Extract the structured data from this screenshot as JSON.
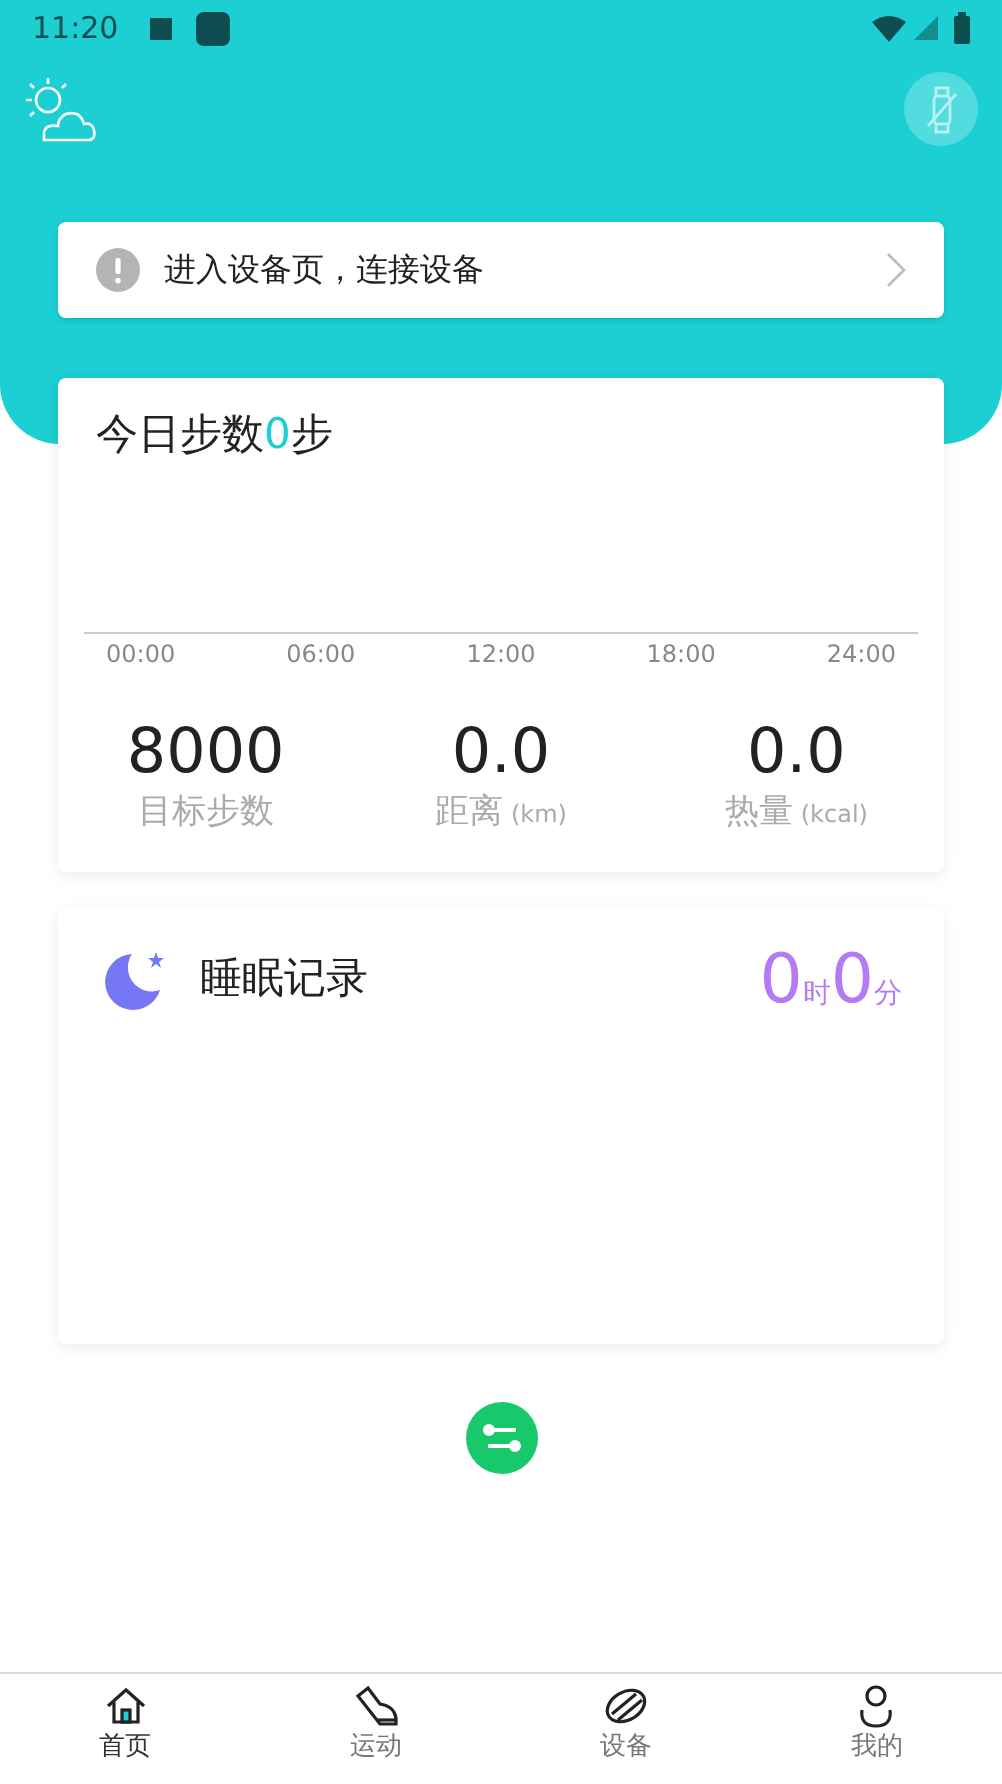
{
  "status_bar": {
    "time": "11:20"
  },
  "notice": {
    "text": "进入设备页，连接设备"
  },
  "steps": {
    "title_prefix": "今日步数",
    "count": "0",
    "title_suffix": "步",
    "axis_labels": [
      "00:00",
      "06:00",
      "12:00",
      "18:00",
      "24:00"
    ],
    "stats": [
      {
        "value": "8000",
        "label": "目标步数"
      },
      {
        "value": "0.0",
        "label": "距离",
        "unit": "(km)"
      },
      {
        "value": "0.0",
        "label": "热量",
        "unit": "(kcal)"
      }
    ]
  },
  "sleep": {
    "title": "睡眠记录",
    "hours": "0",
    "hours_unit": "时",
    "minutes": "0",
    "minutes_unit": "分"
  },
  "nav": [
    {
      "label": "首页",
      "kind": "home",
      "selected": true
    },
    {
      "label": "运动",
      "kind": "shoe",
      "selected": false
    },
    {
      "label": "设备",
      "kind": "band",
      "selected": false
    },
    {
      "label": "我的",
      "kind": "person",
      "selected": false
    }
  ]
}
